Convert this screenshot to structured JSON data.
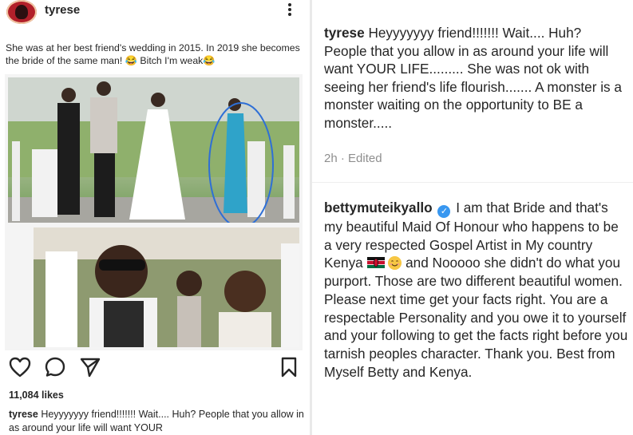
{
  "post": {
    "username": "tyrese",
    "caption_top": "She was at her best friend's wedding in 2015. In 2019 she becomes the bride of the same man! 😂 Bitch I'm weak😂",
    "likes": "11,084 likes",
    "caption_user": "tyrese",
    "caption_bottom": "Heyyyyyyy friend!!!!!!! Wait.... Huh? People that you allow in as around  your life will want YOUR"
  },
  "icons": {
    "more": "more-vertical-icon",
    "like": "heart-icon",
    "comment": "comment-icon",
    "share": "send-icon",
    "save": "bookmark-icon",
    "verified": "verified-badge-icon",
    "flag": "kenya-flag-emoji",
    "smile": "smiling-face-emoji",
    "laugh": "tears-of-joy-emoji"
  },
  "comments": [
    {
      "user": "tyrese",
      "text": "Heyyyyyyy friend!!!!!!! Wait.... Huh? People that you allow in as around  your life will want YOUR LIFE......... She was not ok with seeing her friend's life flourish....... A monster is a monster waiting on the opportunity to BE a monster.....",
      "meta": "2h · Edited"
    },
    {
      "user": "bettymuteikyallo",
      "text_a": "I am that Bride and that's my beautiful Maid Of Honour who happens to be a very respected Gospel Artist in My country Kenya",
      "text_b": "and Nooooo she didn't do what you purport. Those are two different beautiful women. Please next time get your facts right. You are a respectable Personality and you owe it to yourself and your following to get the facts right before you tarnish peoples character. Thank you.  Best from Myself Betty and Kenya."
    }
  ],
  "colors": {
    "text": "#262626",
    "muted": "#8e8e8e",
    "verified": "#3897f0",
    "avatar": "#b2202a"
  }
}
